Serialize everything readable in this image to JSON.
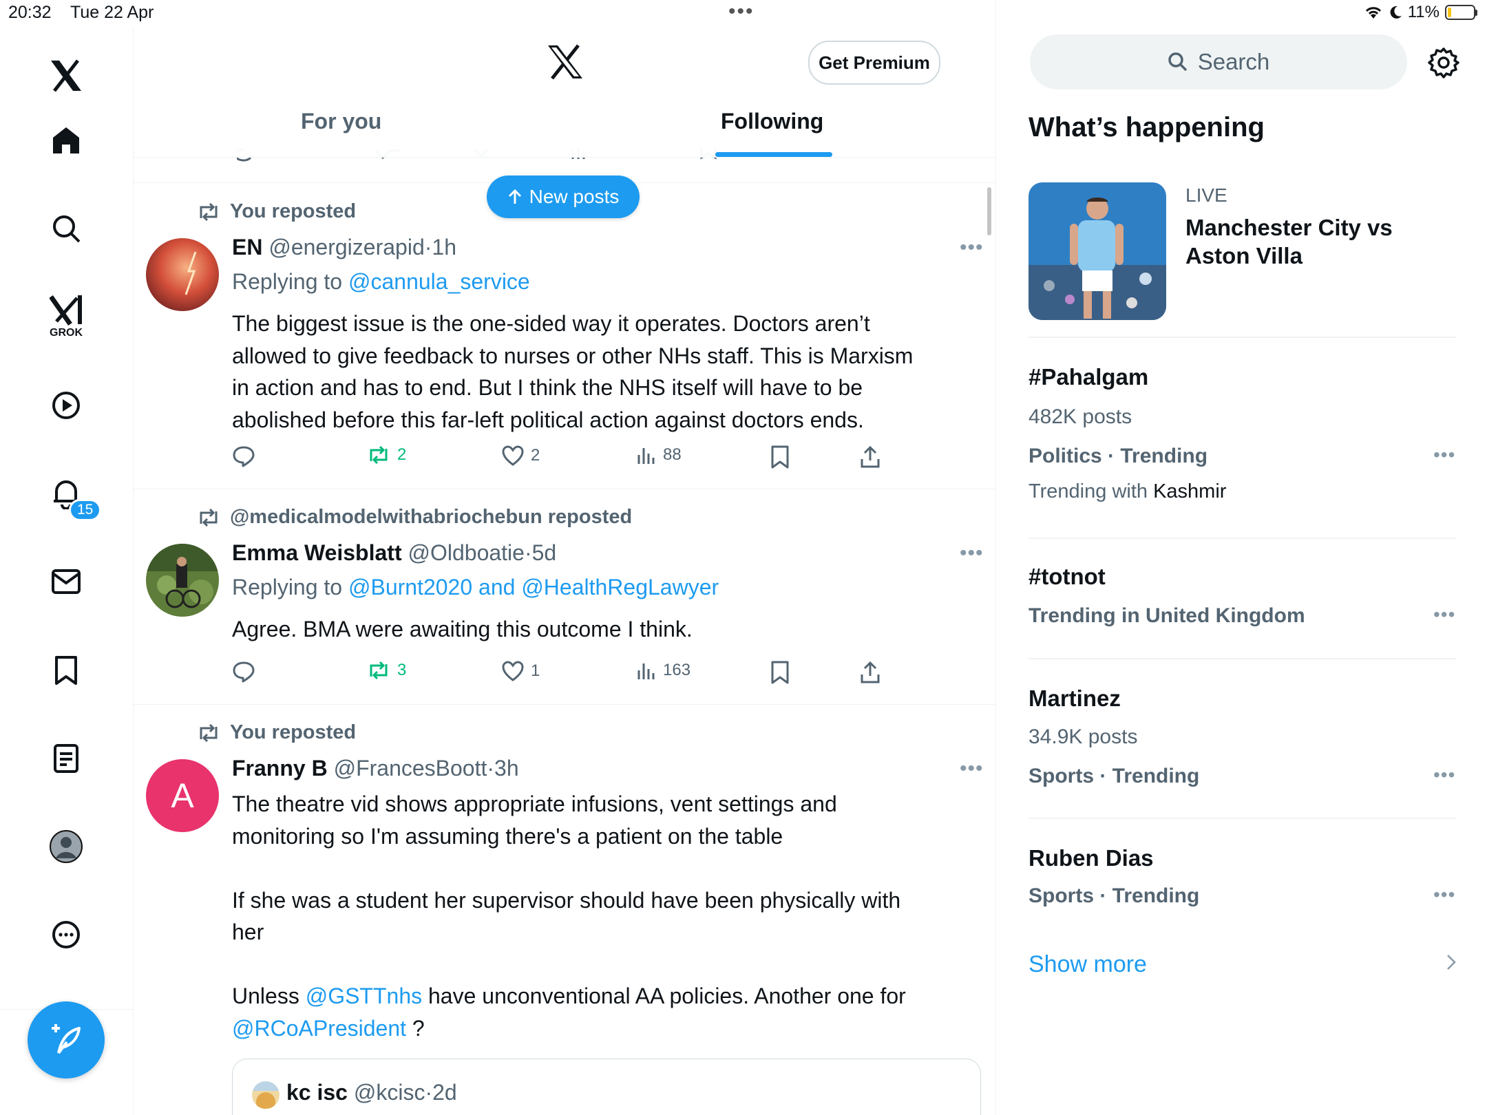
{
  "status_bar": {
    "time": "20:32",
    "date": "Tue 22 Apr",
    "battery": "11%"
  },
  "left_nav": {
    "grok_label": "GROK",
    "notifications_badge": "15",
    "items": [
      "x-logo-icon",
      "home-icon",
      "search-icon",
      "grok-icon",
      "video-icon",
      "notifications-icon",
      "messages-icon",
      "bookmarks-icon",
      "lists-icon",
      "profile-icon",
      "more-icon"
    ]
  },
  "header": {
    "premium_label": "Get Premium",
    "tabs": [
      {
        "label": "For you",
        "active": false
      },
      {
        "label": "Following",
        "active": true
      }
    ]
  },
  "new_posts_label": "New posts",
  "posts": [
    {
      "repost_text": "You reposted",
      "name": "EN",
      "handle": "@energizerapid",
      "sep": "·",
      "time": "1h",
      "replying_prefix": "Replying to",
      "replying_to": "@cannula_service",
      "text_lines": [
        "The biggest issue is the one-sided way it operates. Doctors aren’t",
        "allowed to give feedback to nurses or other NHs staff. This is Marxism",
        "in action and has to end. But I think the NHS itself will have to be",
        "abolished before this far-left political action against doctors ends."
      ],
      "reposts": "2",
      "likes": "2",
      "views": "88"
    },
    {
      "repost_text": "@medicalmodelwithabriochebun reposted",
      "name": "Emma Weisblatt",
      "handle": "@Oldboatie",
      "sep": "·",
      "time": "5d",
      "replying_prefix": "Replying to",
      "replying_to": "@Burnt2020 and @HealthRegLawyer",
      "text": "Agree. BMA were awaiting this outcome I think.",
      "reposts": "3",
      "likes": "1",
      "views": "163"
    },
    {
      "repost_text": "You reposted",
      "name": "Franny B",
      "handle": "@FrancesBoott",
      "sep": "·",
      "time": "3h",
      "avatar_letter": "A",
      "line1": "The theatre vid shows appropriate infusions, vent settings and",
      "line2": "monitoring so I'm assuming there's a patient on the table",
      "line3": "If she was a student her supervisor should have been physically with",
      "line4": "her",
      "line5_pre": "Unless ",
      "line5_link": "@GSTTnhs",
      "line5_post": " have unconventional AA policies. Another one for",
      "line6_link": "@RCoAPresident",
      "line6_post": " ?",
      "quote": {
        "name": "kc isc",
        "handle": "@kcisc",
        "sep": "·",
        "time": "2d"
      }
    }
  ],
  "right": {
    "search_placeholder": "Search",
    "trends_title": "What’s happening",
    "live": {
      "tag": "LIVE",
      "title_line1": "Manchester City vs",
      "title_line2": "Aston Villa"
    },
    "trends": [
      {
        "title": "#Pahalgam",
        "posts": "482K posts",
        "category": "Politics · Trending",
        "with_prefix": "Trending with",
        "with_value": "Kashmir"
      },
      {
        "title": "#totnot",
        "category": "Trending in United Kingdom"
      },
      {
        "title": "Martinez",
        "posts": "34.9K posts",
        "category": "Sports · Trending"
      },
      {
        "title": "Ruben Dias",
        "category": "Sports · Trending"
      }
    ],
    "show_more": "Show more"
  },
  "colors": {
    "accent": "#1d9bf0",
    "repost_green": "#00ba7c",
    "muted_text": "#536471",
    "avatar_pink": "#e8336d"
  }
}
